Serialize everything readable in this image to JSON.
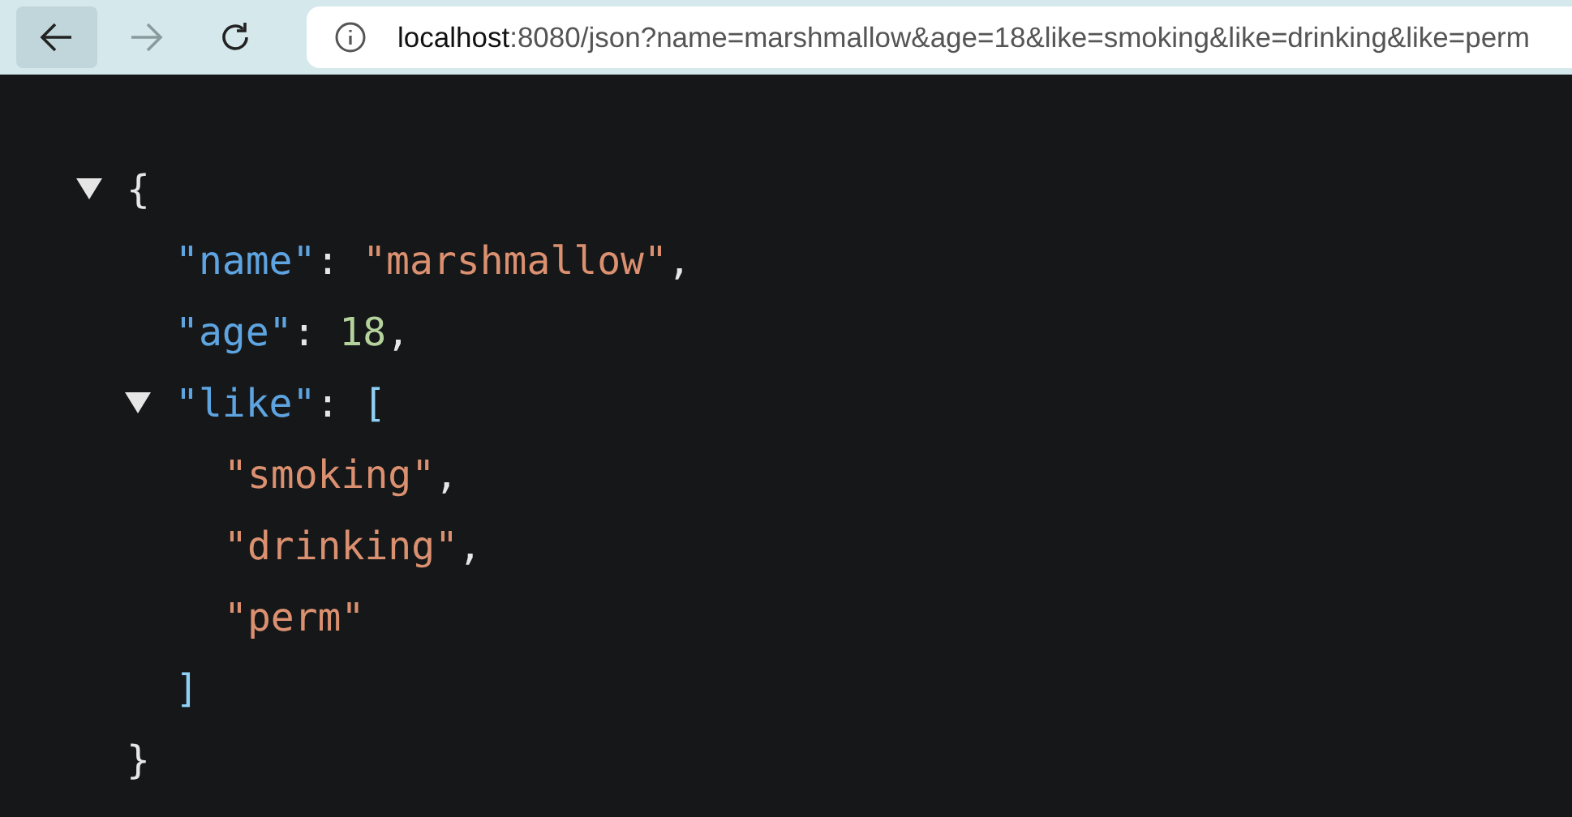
{
  "toolbar": {
    "nav_buttons": [
      {
        "kind": "back",
        "disabled": false,
        "highlighted": true
      },
      {
        "kind": "forward",
        "disabled": true,
        "highlighted": false
      },
      {
        "kind": "reload",
        "disabled": false,
        "highlighted": false
      }
    ],
    "address": {
      "host": "localhost",
      "rest": ":8080/json?name=marshmallow&age=18&like=smoking&like=drinking&like=perm"
    }
  },
  "viewer": {
    "root": {
      "expanded": true,
      "tokens": [
        {
          "kind": "punct",
          "text": "{"
        }
      ],
      "close_tokens": [
        {
          "kind": "punct",
          "text": "}"
        }
      ],
      "children": [
        {
          "tokens": [
            {
              "kind": "key",
              "text": "\"name\""
            },
            {
              "kind": "punct",
              "text": ": "
            },
            {
              "kind": "string",
              "text": "\"marshmallow\""
            },
            {
              "kind": "punct",
              "text": ","
            }
          ]
        },
        {
          "tokens": [
            {
              "kind": "key",
              "text": "\"age\""
            },
            {
              "kind": "punct",
              "text": ": "
            },
            {
              "kind": "number",
              "text": "18"
            },
            {
              "kind": "punct",
              "text": ","
            }
          ]
        },
        {
          "expanded": true,
          "tokens": [
            {
              "kind": "key",
              "text": "\"like\""
            },
            {
              "kind": "punct",
              "text": ": "
            },
            {
              "kind": "bracket",
              "text": "["
            }
          ],
          "close_tokens": [
            {
              "kind": "bracket",
              "text": "]"
            }
          ],
          "children": [
            {
              "tokens": [
                {
                  "kind": "string",
                  "text": "\"smoking\""
                },
                {
                  "kind": "punct",
                  "text": ","
                }
              ]
            },
            {
              "tokens": [
                {
                  "kind": "string",
                  "text": "\"drinking\""
                },
                {
                  "kind": "punct",
                  "text": ","
                }
              ]
            },
            {
              "tokens": [
                {
                  "kind": "string",
                  "text": "\"perm\""
                }
              ]
            }
          ]
        }
      ]
    }
  }
}
